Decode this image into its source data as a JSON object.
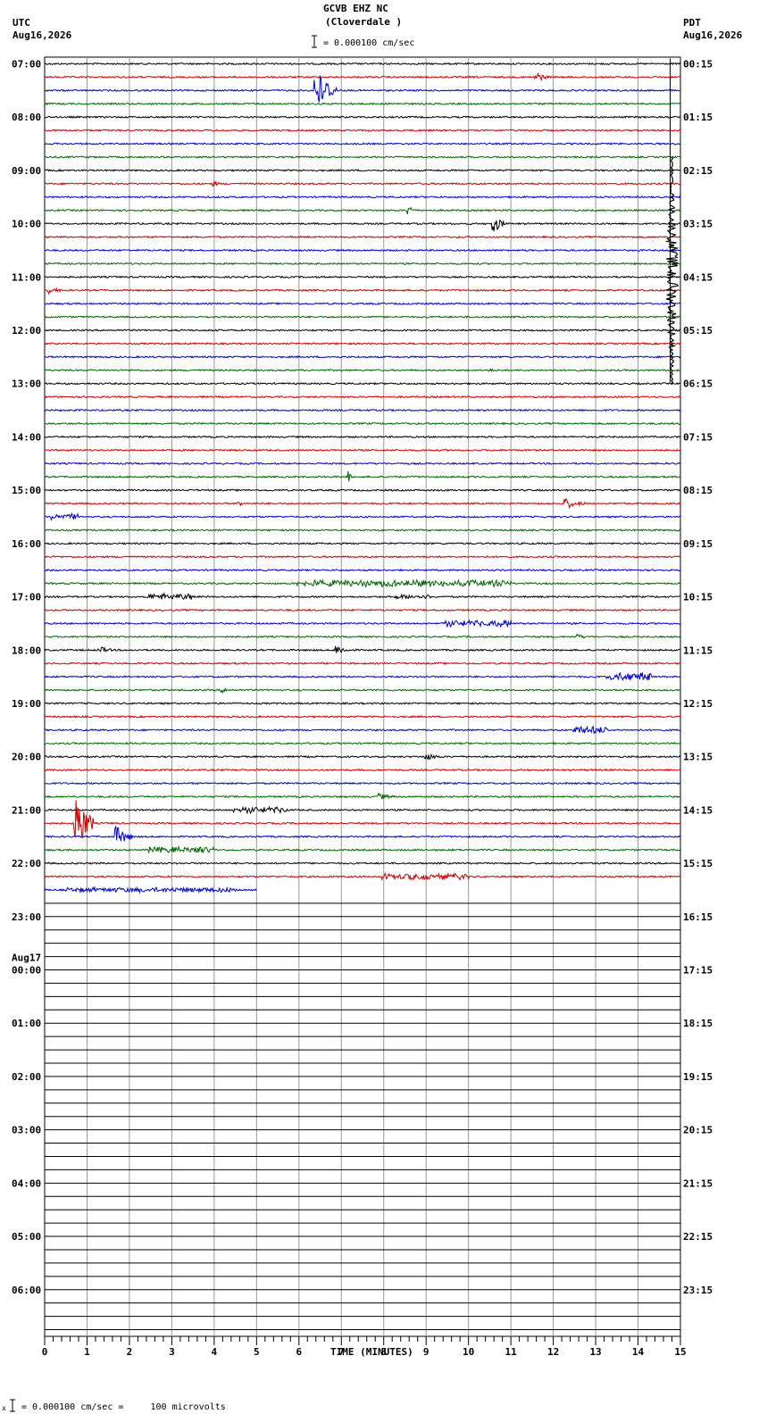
{
  "header": {
    "station": "GCVB EHZ NC",
    "location": "(Cloverdale )",
    "scale_text": "= 0.000100 cm/sec",
    "left_zone": "UTC",
    "left_date": "Aug16,2026",
    "right_zone": "PDT",
    "right_date": "Aug16,2026"
  },
  "footer": {
    "scale_text": "= 0.000100 cm/sec =     100 microvolts",
    "mark": "x"
  },
  "chart_data": {
    "type": "line",
    "title": "GCVB EHZ NC (Cloverdale )",
    "xlabel": "TIME (MINUTES)",
    "xlim": [
      0,
      15
    ],
    "x_ticks": [
      "0",
      "1",
      "2",
      "3",
      "4",
      "5",
      "6",
      "7",
      "8",
      "9",
      "10",
      "11",
      "12",
      "13",
      "14",
      "15"
    ],
    "grid": true,
    "rows": 96,
    "rows_per_hour": 4,
    "traces_recorded": 63,
    "last_trace_end_minute": 5,
    "trace_colors": [
      "#000000",
      "#cc0000",
      "#0000cc",
      "#006600"
    ],
    "left_hour_labels": [
      {
        "row": 0,
        "text": "07:00"
      },
      {
        "row": 4,
        "text": "08:00"
      },
      {
        "row": 8,
        "text": "09:00"
      },
      {
        "row": 12,
        "text": "10:00"
      },
      {
        "row": 16,
        "text": "11:00"
      },
      {
        "row": 20,
        "text": "12:00"
      },
      {
        "row": 24,
        "text": "13:00"
      },
      {
        "row": 28,
        "text": "14:00"
      },
      {
        "row": 32,
        "text": "15:00"
      },
      {
        "row": 36,
        "text": "16:00"
      },
      {
        "row": 40,
        "text": "17:00"
      },
      {
        "row": 44,
        "text": "18:00"
      },
      {
        "row": 48,
        "text": "19:00"
      },
      {
        "row": 52,
        "text": "20:00"
      },
      {
        "row": 56,
        "text": "21:00"
      },
      {
        "row": 60,
        "text": "22:00"
      },
      {
        "row": 64,
        "text": "23:00"
      },
      {
        "row": 68,
        "text": "00:00"
      },
      {
        "row": 72,
        "text": "01:00"
      },
      {
        "row": 76,
        "text": "02:00"
      },
      {
        "row": 80,
        "text": "03:00"
      },
      {
        "row": 84,
        "text": "04:00"
      },
      {
        "row": 88,
        "text": "05:00"
      },
      {
        "row": 92,
        "text": "06:00"
      }
    ],
    "date_change_label": {
      "row": 68,
      "text": "Aug17"
    },
    "right_hour_labels": [
      {
        "row": 0,
        "text": "00:15"
      },
      {
        "row": 4,
        "text": "01:15"
      },
      {
        "row": 8,
        "text": "02:15"
      },
      {
        "row": 12,
        "text": "03:15"
      },
      {
        "row": 16,
        "text": "04:15"
      },
      {
        "row": 20,
        "text": "05:15"
      },
      {
        "row": 24,
        "text": "06:15"
      },
      {
        "row": 28,
        "text": "07:15"
      },
      {
        "row": 32,
        "text": "08:15"
      },
      {
        "row": 36,
        "text": "09:15"
      },
      {
        "row": 40,
        "text": "10:15"
      },
      {
        "row": 44,
        "text": "11:15"
      },
      {
        "row": 48,
        "text": "12:15"
      },
      {
        "row": 52,
        "text": "13:15"
      },
      {
        "row": 56,
        "text": "14:15"
      },
      {
        "row": 60,
        "text": "15:15"
      },
      {
        "row": 64,
        "text": "16:15"
      },
      {
        "row": 68,
        "text": "17:15"
      },
      {
        "row": 72,
        "text": "18:15"
      },
      {
        "row": 76,
        "text": "19:15"
      },
      {
        "row": 80,
        "text": "20:15"
      },
      {
        "row": 84,
        "text": "21:15"
      },
      {
        "row": 88,
        "text": "22:15"
      },
      {
        "row": 92,
        "text": "23:15"
      }
    ],
    "events": [
      {
        "row": 1,
        "minute": 11.6,
        "amp": 6,
        "dur": 0.3
      },
      {
        "row": 2,
        "minute": 6.4,
        "amp": 26,
        "dur": 0.5
      },
      {
        "row": 9,
        "minute": 4.0,
        "amp": 3,
        "dur": 0.2
      },
      {
        "row": 11,
        "minute": 8.6,
        "amp": 6,
        "dur": 0.15
      },
      {
        "row": 12,
        "minute": 10.6,
        "amp": 10,
        "dur": 0.3
      },
      {
        "row": 17,
        "minute": 0.1,
        "amp": 4,
        "dur": 0.4
      },
      {
        "row": 23,
        "minute": 10.5,
        "amp": 2,
        "dur": 0.3
      },
      {
        "row": 31,
        "minute": 7.15,
        "amp": 7,
        "dur": 0.1
      },
      {
        "row": 33,
        "minute": 12.3,
        "amp": 6,
        "dur": 0.5
      },
      {
        "row": 33,
        "minute": 4.6,
        "amp": 3,
        "dur": 0.15
      },
      {
        "row": 34,
        "minute": 0.2,
        "amp": 4,
        "dur": 0.6
      },
      {
        "row": 39,
        "minute": 6.0,
        "amp": 4,
        "dur": 5.0
      },
      {
        "row": 40,
        "minute": 2.5,
        "amp": 4,
        "dur": 1.0
      },
      {
        "row": 40,
        "minute": 8.3,
        "amp": 3,
        "dur": 0.8
      },
      {
        "row": 42,
        "minute": 9.5,
        "amp": 4,
        "dur": 1.5
      },
      {
        "row": 43,
        "minute": 12.6,
        "amp": 3,
        "dur": 0.3
      },
      {
        "row": 44,
        "minute": 1.3,
        "amp": 4,
        "dur": 0.4
      },
      {
        "row": 44,
        "minute": 6.9,
        "amp": 6,
        "dur": 0.3
      },
      {
        "row": 46,
        "minute": 13.3,
        "amp": 5,
        "dur": 1.0
      },
      {
        "row": 47,
        "minute": 4.2,
        "amp": 3,
        "dur": 0.4
      },
      {
        "row": 50,
        "minute": 12.5,
        "amp": 5,
        "dur": 0.8
      },
      {
        "row": 52,
        "minute": 9.0,
        "amp": 4,
        "dur": 0.5
      },
      {
        "row": 55,
        "minute": 7.9,
        "amp": 4,
        "dur": 0.4
      },
      {
        "row": 56,
        "minute": 4.5,
        "amp": 4,
        "dur": 1.2
      },
      {
        "row": 57,
        "minute": 0.75,
        "amp": 34,
        "dur": 0.4
      },
      {
        "row": 58,
        "minute": 1.7,
        "amp": 12,
        "dur": 0.4
      },
      {
        "row": 59,
        "minute": 2.5,
        "amp": 4,
        "dur": 1.5
      },
      {
        "row": 61,
        "minute": 8.0,
        "amp": 4,
        "dur": 2.0
      },
      {
        "row": 62,
        "minute": 0.5,
        "amp": 3,
        "dur": 4.0
      }
    ],
    "large_event": {
      "row": 16,
      "minute": 14.8,
      "amp": 70,
      "extent_rows": [
        7,
        24
      ]
    }
  }
}
